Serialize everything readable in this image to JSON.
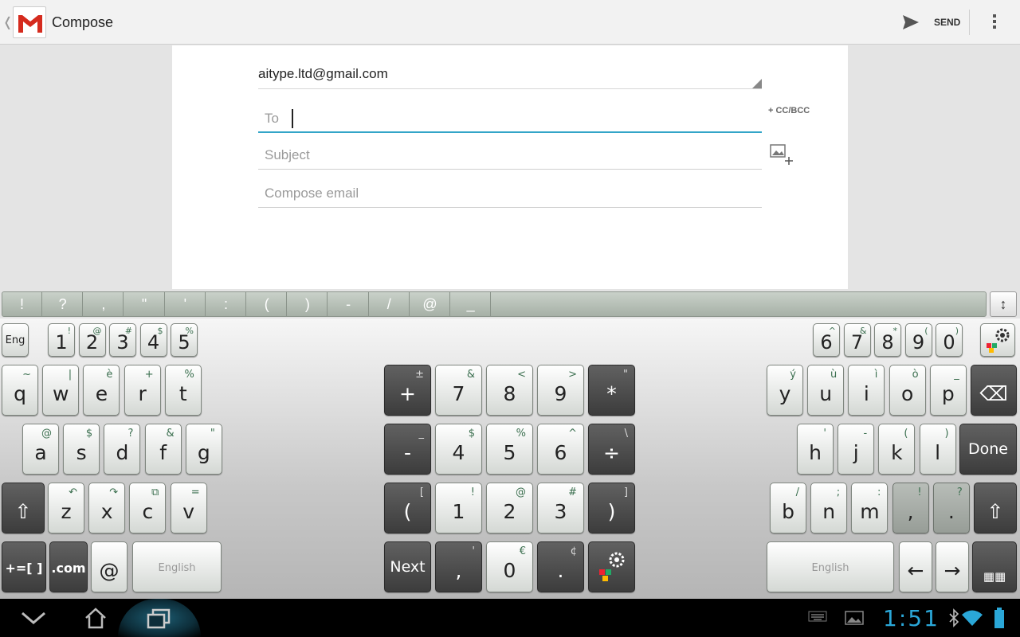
{
  "actionbar": {
    "title": "Compose",
    "send_label": "SEND",
    "icons": [
      "up-caret-icon",
      "gmail-logo-icon",
      "send-icon",
      "overflow-menu-icon"
    ]
  },
  "compose": {
    "from": "aitype.ltd@gmail.com",
    "to_placeholder": "To",
    "subject_placeholder": "Subject",
    "body_placeholder": "Compose email",
    "ccbcc_label": "+ CC/BCC"
  },
  "suggestions": [
    "!",
    "?",
    ",",
    "\"",
    "'",
    ":",
    "(",
    ")",
    "-",
    "/",
    "@",
    "_"
  ],
  "keyboard": {
    "lang_key": "Eng",
    "num_left": [
      {
        "m": "1",
        "a": "!"
      },
      {
        "m": "2",
        "a": "@"
      },
      {
        "m": "3",
        "a": "#"
      },
      {
        "m": "4",
        "a": "$"
      },
      {
        "m": "5",
        "a": "%"
      }
    ],
    "num_right": [
      {
        "m": "6",
        "a": "^"
      },
      {
        "m": "7",
        "a": "&"
      },
      {
        "m": "8",
        "a": "*"
      },
      {
        "m": "9",
        "a": "("
      },
      {
        "m": "0",
        "a": ")"
      }
    ],
    "row1_left": [
      {
        "m": "q",
        "a": "~"
      },
      {
        "m": "w",
        "a": "|"
      },
      {
        "m": "e",
        "a": "è"
      },
      {
        "m": "r",
        "a": "+"
      },
      {
        "m": "t",
        "a": "%"
      }
    ],
    "row1_right": [
      {
        "m": "y",
        "a": "ý"
      },
      {
        "m": "u",
        "a": "ù"
      },
      {
        "m": "i",
        "a": "ì"
      },
      {
        "m": "o",
        "a": "ò"
      },
      {
        "m": "p",
        "a": "_"
      }
    ],
    "row2_left": [
      {
        "m": "a",
        "a": "@"
      },
      {
        "m": "s",
        "a": "$"
      },
      {
        "m": "d",
        "a": "?"
      },
      {
        "m": "f",
        "a": "&"
      },
      {
        "m": "g",
        "a": "\""
      }
    ],
    "row2_right": [
      {
        "m": "h",
        "a": "'"
      },
      {
        "m": "j",
        "a": "-"
      },
      {
        "m": "k",
        "a": "("
      },
      {
        "m": "l",
        "a": ")"
      }
    ],
    "row3_left": [
      {
        "m": "z",
        "a": "↶"
      },
      {
        "m": "x",
        "a": "↷"
      },
      {
        "m": "c",
        "a": "⧉"
      },
      {
        "m": "v",
        "a": "="
      }
    ],
    "row3_right": [
      {
        "m": "b",
        "a": "/"
      },
      {
        "m": "n",
        "a": ";"
      },
      {
        "m": "m",
        "a": ":"
      },
      {
        "m": ",",
        "a": "!"
      },
      {
        "m": ".",
        "a": "?"
      }
    ],
    "numpad": [
      [
        {
          "m": "+",
          "a": "±",
          "dark": true
        },
        {
          "m": "7",
          "a": "&"
        },
        {
          "m": "8",
          "a": "<"
        },
        {
          "m": "9",
          "a": ">"
        },
        {
          "m": "*",
          "a": "\"",
          "dark": true
        }
      ],
      [
        {
          "m": "-",
          "a": "_",
          "dark": true
        },
        {
          "m": "4",
          "a": "$"
        },
        {
          "m": "5",
          "a": "%"
        },
        {
          "m": "6",
          "a": "^"
        },
        {
          "m": "÷",
          "a": "\\",
          "dark": true
        }
      ],
      [
        {
          "m": "(",
          "a": "[",
          "dark": true
        },
        {
          "m": "1",
          "a": "!"
        },
        {
          "m": "2",
          "a": "@"
        },
        {
          "m": "3",
          "a": "#"
        },
        {
          "m": ")",
          "a": "]",
          "dark": true
        }
      ]
    ],
    "numpad_bottom": {
      "next": "Next",
      "comma": ",",
      "comma_alt": "'",
      "zero": "0",
      "zero_alt": "€",
      "dot": ".",
      "dot_alt": "¢"
    },
    "symbols_key": "+=[ ]",
    "dotcom_key": ".com",
    "at_key": "@",
    "space_label": "English",
    "done_label": "Done"
  },
  "statusbar": {
    "time": "1:51"
  }
}
